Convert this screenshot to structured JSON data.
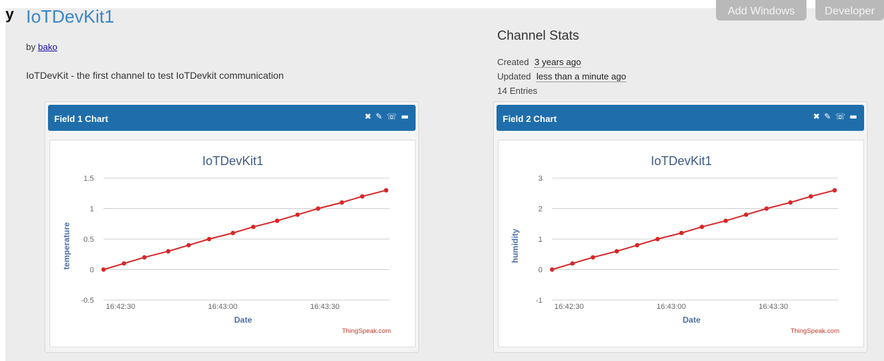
{
  "header": {
    "corner_glyph": "y",
    "channel_title": "IoTDevKit1",
    "byline_prefix": "by",
    "author": "bako",
    "description": "IoTDevKit - the first channel to test IoTDevkit communication"
  },
  "top_buttons": {
    "add_windows": "Add Windows",
    "developer": "Developer"
  },
  "channel_stats": {
    "heading": "Channel Stats",
    "created_label": "Created",
    "created_value": "3 years ago",
    "updated_label": "Updated",
    "updated_value": "less than a minute ago",
    "entries": "14 Entries"
  },
  "panels": [
    {
      "title": "Field 1 Chart",
      "icons": [
        "close-icon",
        "edit-icon",
        "comment-icon",
        "minimize-icon"
      ],
      "credit": "ThingSpeak.com"
    },
    {
      "title": "Field 2 Chart",
      "icons": [
        "close-icon",
        "edit-icon",
        "comment-icon",
        "minimize-icon"
      ],
      "credit": "ThingSpeak.com"
    }
  ],
  "chart_data": [
    {
      "type": "line",
      "title": "IoTDevKit1",
      "xlabel": "Date",
      "ylabel": "temperature",
      "ylim": [
        -0.5,
        1.5
      ],
      "yticks": [
        "1.5",
        "1",
        "0.5",
        "0",
        "-0.5"
      ],
      "ytick_values": [
        1.5,
        1,
        0.5,
        0,
        -0.5
      ],
      "x_tick_labels": [
        "16:42:30",
        "16:43:00",
        "16:43:30"
      ],
      "x_tick_values": [
        5,
        35,
        65
      ],
      "xlim": [
        0,
        84
      ],
      "x": [
        0,
        6,
        12,
        19,
        25,
        31,
        38,
        44,
        51,
        57,
        63,
        70,
        76,
        83
      ],
      "series": [
        {
          "color": "#d62728",
          "values": [
            0,
            0.1,
            0.2,
            0.3,
            0.4,
            0.5,
            0.6,
            0.7,
            0.8,
            0.9,
            1.0,
            1.1,
            1.2,
            1.3
          ]
        }
      ],
      "grid": true,
      "legend": "none",
      "credit": "ThingSpeak.com"
    },
    {
      "type": "line",
      "title": "IoTDevKit1",
      "xlabel": "Date",
      "ylabel": "humidity",
      "ylim": [
        -1,
        3
      ],
      "yticks": [
        "3",
        "2",
        "1",
        "0",
        "-1"
      ],
      "ytick_values": [
        3,
        2,
        1,
        0,
        -1
      ],
      "x_tick_labels": [
        "16:42:30",
        "16:43:00",
        "16:43:30"
      ],
      "x_tick_values": [
        5,
        35,
        65
      ],
      "xlim": [
        0,
        84
      ],
      "x": [
        0,
        6,
        12,
        19,
        25,
        31,
        38,
        44,
        51,
        57,
        63,
        70,
        76,
        83
      ],
      "series": [
        {
          "color": "#d62728",
          "values": [
            0,
            0.2,
            0.4,
            0.6,
            0.8,
            1.0,
            1.2,
            1.4,
            1.6,
            1.8,
            2.0,
            2.2,
            2.4,
            2.6
          ]
        }
      ],
      "grid": true,
      "legend": "none",
      "credit": "ThingSpeak.com"
    }
  ]
}
